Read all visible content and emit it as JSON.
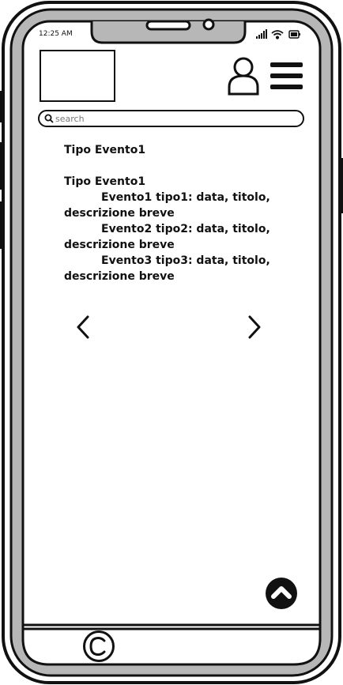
{
  "status": {
    "time": "12:25 AM"
  },
  "icons": {
    "signal": "signal-icon",
    "wifi": "wifi-icon",
    "battery": "battery-icon",
    "user": "user-icon",
    "menu": "hamburger-menu-icon",
    "search": "search-icon",
    "prev": "chevron-left-icon",
    "next": "chevron-right-icon",
    "top": "chevron-up-icon",
    "copyright": "copyright-icon"
  },
  "search": {
    "placeholder": "search"
  },
  "content": {
    "heading1": "Tipo Evento1",
    "heading2": "Tipo Evento1",
    "events": [
      {
        "title": "Evento1 tipo1: data, titolo,",
        "desc": "descrizione breve"
      },
      {
        "title": "Evento2 tipo2: data, titolo,",
        "desc": "descrizione breve"
      },
      {
        "title": "Evento3 tipo3: data, titolo,",
        "desc": "descrizione breve"
      }
    ]
  }
}
